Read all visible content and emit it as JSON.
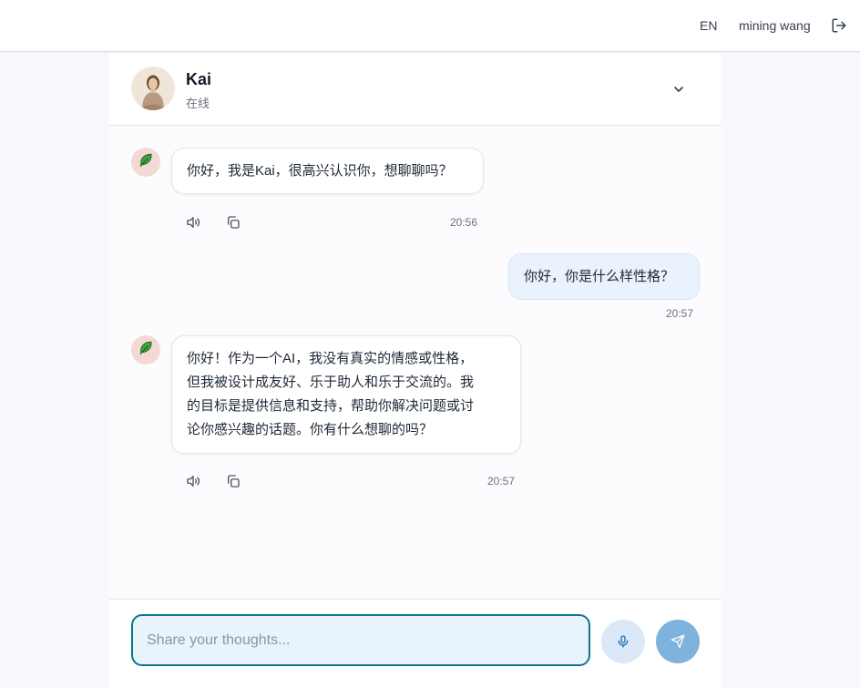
{
  "topbar": {
    "language": "EN",
    "username": "mining wang",
    "logout_icon": "logout-icon"
  },
  "chat": {
    "name": "Kai",
    "status": "在线",
    "expand_icon": "chevron-down-icon"
  },
  "messages": [
    {
      "role": "bot",
      "text": "你好，我是Kai，很高兴认识你，想聊聊吗？",
      "time": "20:56"
    },
    {
      "role": "user",
      "text": "你好，你是什么样性格？",
      "time": "20:57"
    },
    {
      "role": "bot",
      "lines": [
        "你好！作为一个AI，我没有真实的情感或性格，",
        "但我被设计成友好、乐于助人和乐于交流的。我",
        "的目标是提供信息和支持，帮助你解决问题或讨",
        "论你感兴趣的话题。你有什么想聊的吗？"
      ],
      "time": "20:57"
    }
  ],
  "composer": {
    "placeholder": "Share your thoughts...",
    "value": ""
  },
  "colors": {
    "accent": "#0e7490",
    "user_bubble": "#eaf2fd",
    "send_button": "#7fb2dd",
    "bot_avatar_bg": "#f3d9d4"
  }
}
